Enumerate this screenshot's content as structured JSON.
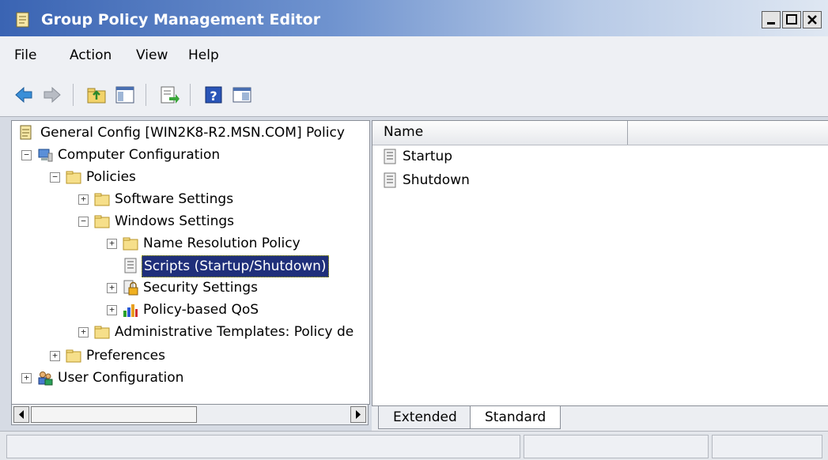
{
  "window": {
    "title": "Group Policy Management Editor",
    "titlebar_color": "#3a64b3",
    "selection_color": "#1f2f7a"
  },
  "menu": {
    "items": [
      {
        "label": "File"
      },
      {
        "label": "Action"
      },
      {
        "label": "View"
      },
      {
        "label": "Help"
      }
    ]
  },
  "toolbar": {
    "icons": [
      "back-arrow-icon",
      "forward-arrow-icon",
      "up-folder-icon",
      "show-hide-tree-icon",
      "export-list-icon",
      "help-icon",
      "properties-icon"
    ]
  },
  "tree": {
    "root": {
      "label": "General Config [WIN2K8-R2.MSN.COM] Policy",
      "icon": "policy-document-icon"
    },
    "items": [
      {
        "label": "Computer Configuration",
        "expander": "−",
        "icon": "computer-icon"
      },
      {
        "label": "Policies",
        "expander": "−",
        "icon": "folder-icon"
      },
      {
        "label": "Software Settings",
        "expander": "+",
        "icon": "folder-icon"
      },
      {
        "label": "Windows Settings",
        "expander": "−",
        "icon": "folder-icon"
      },
      {
        "label": "Name Resolution Policy",
        "expander": "+",
        "icon": "folder-icon"
      },
      {
        "label": "Scripts (Startup/Shutdown)",
        "expander": "",
        "icon": "script-icon",
        "selected": true
      },
      {
        "label": "Security Settings",
        "expander": "+",
        "icon": "security-lock-icon"
      },
      {
        "label": "Policy-based QoS",
        "expander": "+",
        "icon": "bar-chart-icon"
      },
      {
        "label": "Administrative Templates: Policy de",
        "expander": "+",
        "icon": "folder-icon"
      },
      {
        "label": "Preferences",
        "expander": "+",
        "icon": "folder-icon"
      },
      {
        "label": "User Configuration",
        "expander": "+",
        "icon": "users-icon"
      }
    ]
  },
  "list": {
    "column_header": "Name",
    "rows": [
      {
        "label": "Startup",
        "icon": "script-icon"
      },
      {
        "label": "Shutdown",
        "icon": "script-icon"
      }
    ]
  },
  "tabs": [
    {
      "label": "Extended"
    },
    {
      "label": "Standard",
      "active": true
    }
  ]
}
